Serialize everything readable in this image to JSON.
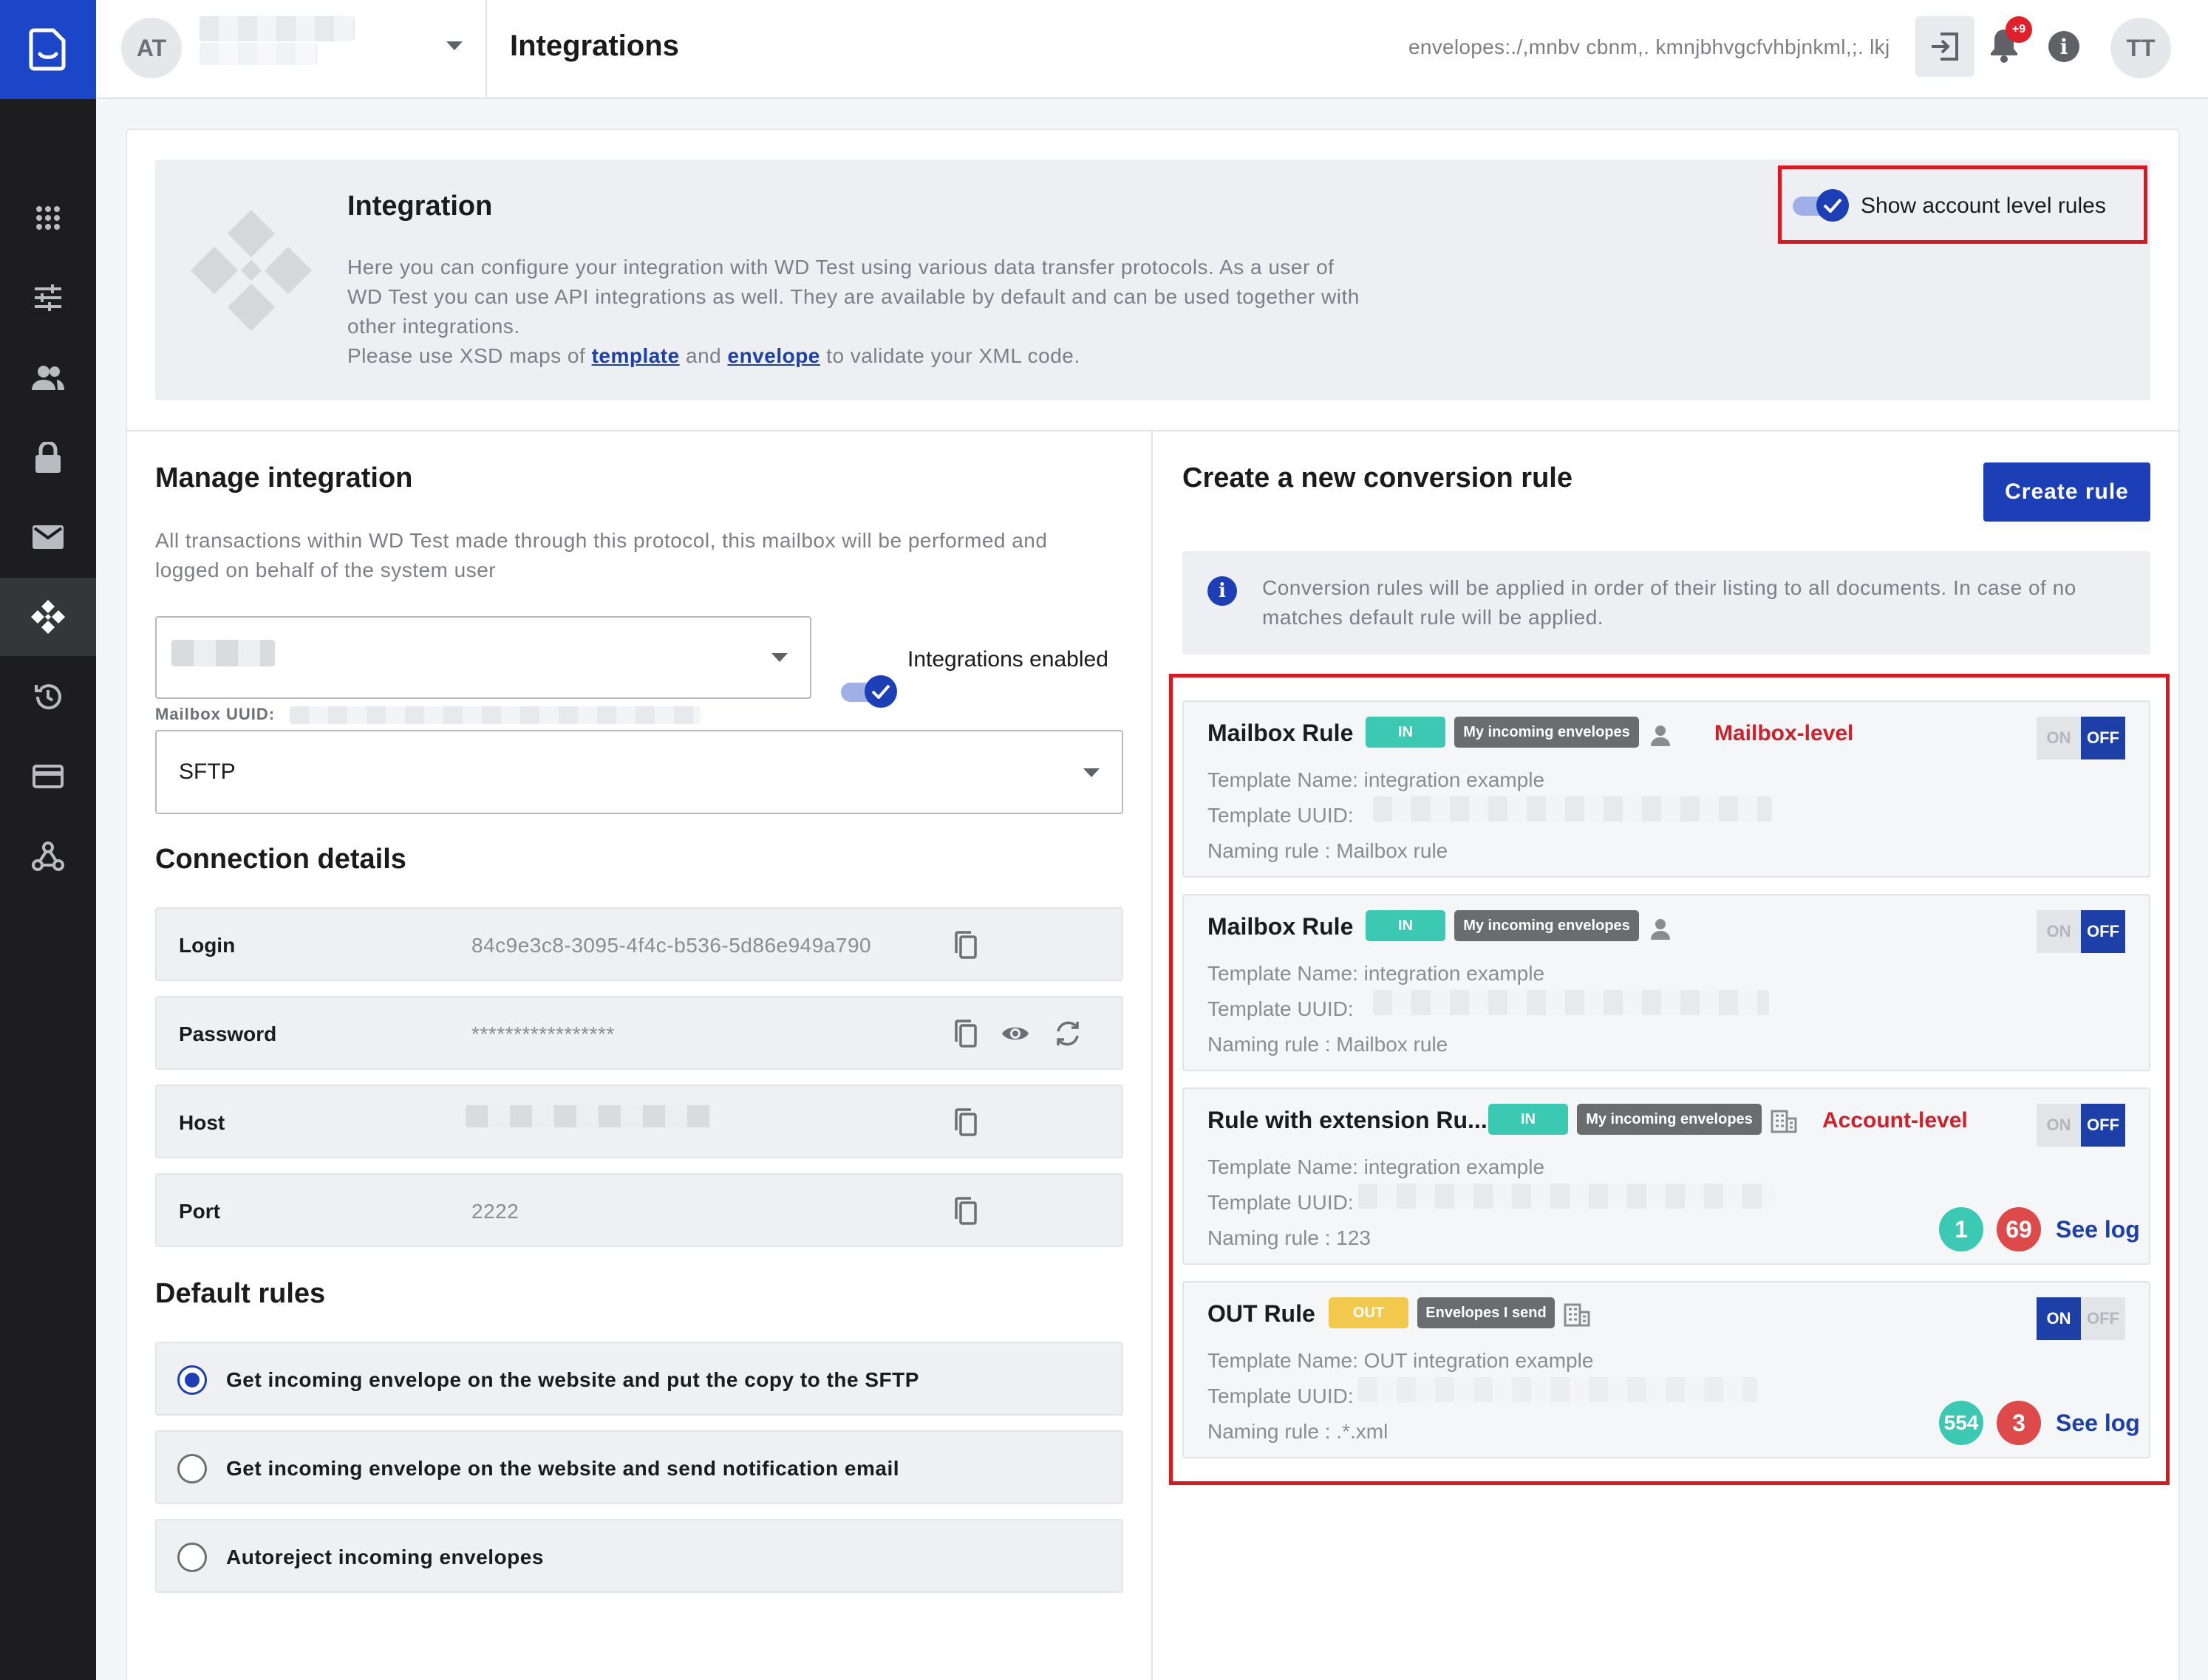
{
  "topbar": {
    "org_avatar": "AT",
    "page_title": "Integrations",
    "search_text": "envelopes:./,mnbv cbnm,. kmnjbhvgcfvhbjnkml,;. lkj",
    "notification_count": "+9",
    "user_avatar": "TT"
  },
  "sidebar": {
    "items": [
      "apps-icon",
      "sliders-icon",
      "users-icon",
      "lock-icon",
      "mail-icon",
      "integrations-icon",
      "history-icon",
      "card-icon",
      "webhook-icon"
    ],
    "active": "integrations-icon"
  },
  "intro": {
    "title": "Integration",
    "line1": "Here you can configure your integration with WD Test using various data transfer protocols. As a user of",
    "line2": "WD Test you can use API integrations as well. They are available by default and can be used together with",
    "line3": "other integrations.",
    "line4_pre": "Please use XSD maps of",
    "template_link": "template",
    "line4_and": "and",
    "envelope_link": "envelope",
    "line4_post": "to validate your XML code.",
    "toggle_label": "Show account level rules"
  },
  "manage": {
    "title": "Manage integration",
    "desc1": "All transactions within WD Test made through this protocol, this mailbox will be performed and",
    "desc2": "logged on behalf of the system user",
    "integrations_toggle_label": "Integrations enabled",
    "mailbox_uuid_label": "Mailbox UUID:",
    "protocol": "SFTP"
  },
  "connection": {
    "title": "Connection details",
    "rows": [
      {
        "label": "Login",
        "value": "84c9e3c8-3095-4f4c-b536-5d86e949a790"
      },
      {
        "label": "Password",
        "value": "*****************"
      },
      {
        "label": "Host",
        "value": ""
      },
      {
        "label": "Port",
        "value": "2222"
      }
    ]
  },
  "default_rules": {
    "title": "Default rules",
    "options": [
      {
        "label": "Get incoming envelope on the website and put the copy to the SFTP",
        "checked": true
      },
      {
        "label": "Get incoming envelope on the website and send notification email",
        "checked": false
      },
      {
        "label": "Autoreject incoming envelopes",
        "checked": false
      }
    ]
  },
  "conversion": {
    "title": "Create a new conversion rule",
    "create_button": "Create rule",
    "info1": "Conversion rules will be applied in order of their listing to all documents. In case of no",
    "info2": "matches default rule will be applied.",
    "on_label": "ON",
    "off_label": "OFF",
    "see_log": "See log",
    "rules": [
      {
        "title": "Mailbox Rule",
        "direction": "IN",
        "scope": "My incoming envelopes",
        "level": "Mailbox-level",
        "template_name": "Template Name: integration example",
        "template_uuid": "Template UUID:",
        "naming": "Naming rule : Mailbox rule",
        "state": "OFF"
      },
      {
        "title": "Mailbox Rule",
        "direction": "IN",
        "scope": "My incoming envelopes",
        "level": "",
        "template_name": "Template Name: integration example",
        "template_uuid": "Template UUID:",
        "naming": "Naming rule : Mailbox rule",
        "state": "OFF"
      },
      {
        "title": "Rule with extension Ru...",
        "direction": "IN",
        "scope": "My incoming envelopes",
        "level": "Account-level",
        "template_name": "Template Name: integration example",
        "template_uuid": "Template UUID:",
        "naming": "Naming rule : 123",
        "state": "OFF",
        "ok": "1",
        "err": "69"
      },
      {
        "title": "OUT Rule",
        "direction": "OUT",
        "scope": "Envelopes I send",
        "level": "",
        "template_name": "Template Name: OUT integration example",
        "template_uuid": "Template UUID:",
        "naming": "Naming rule : .*.xml",
        "state": "ON",
        "ok": "554",
        "err": "3"
      }
    ]
  }
}
